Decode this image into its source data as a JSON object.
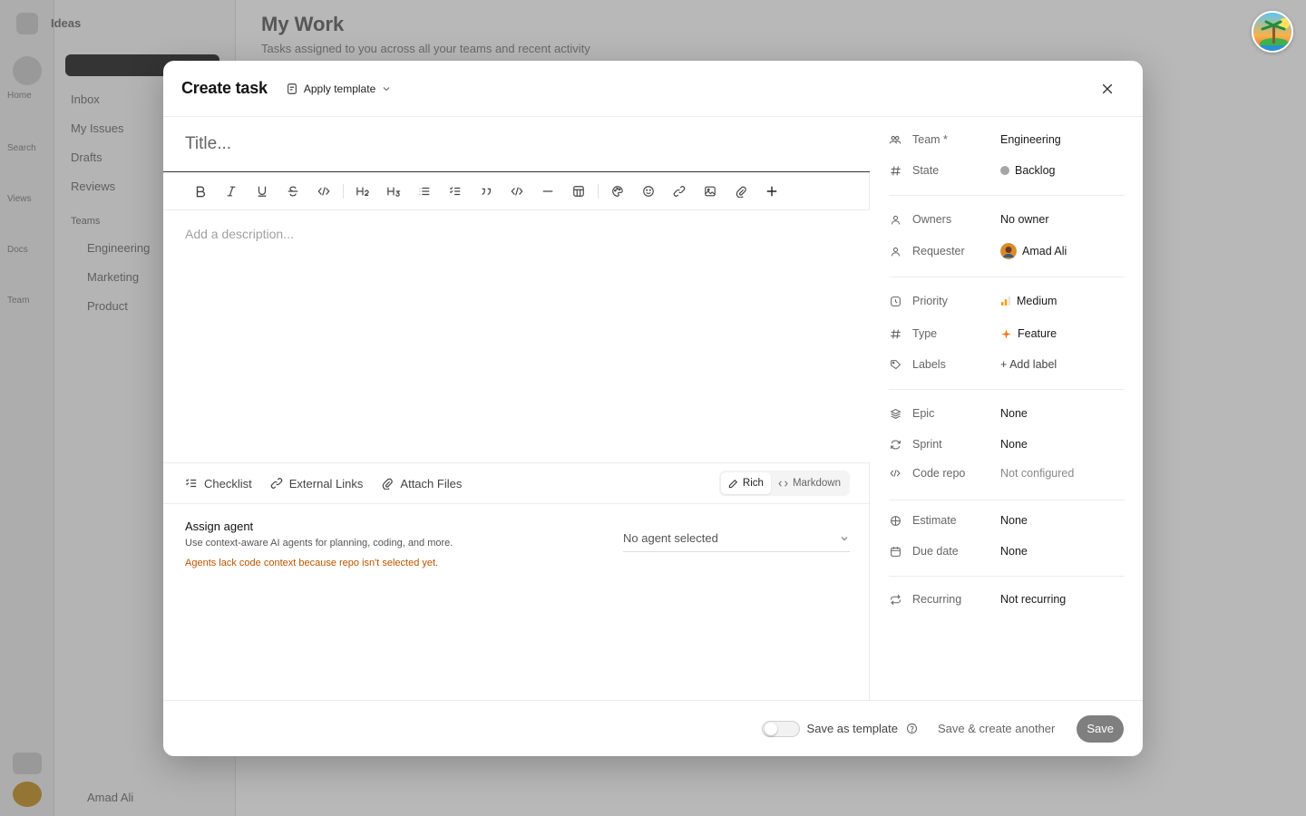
{
  "background": {
    "app_name": "Ideas",
    "page_title": "My Work",
    "page_subtitle": "Tasks assigned to you across all your teams and recent activity",
    "sidebar_items": [
      "Inbox",
      "My Issues",
      "Drafts",
      "Reviews",
      "Teams",
      "Engineering",
      "Marketing",
      "Product"
    ],
    "rail_labels": [
      "Home",
      "Search",
      "Views",
      "Docs",
      "Team"
    ],
    "bottom_user": "Amad Ali"
  },
  "modal": {
    "title": "Create task",
    "apply_template": "Apply template",
    "title_placeholder": "Title...",
    "description_placeholder": "Add a description...",
    "attachments": {
      "checklist": "Checklist",
      "external_links": "External Links",
      "attach_files": "Attach Files"
    },
    "mode": {
      "rich": "Rich",
      "markdown": "Markdown"
    },
    "agent": {
      "title": "Assign agent",
      "description": "Use context-aware AI agents for planning, coding, and more.",
      "warning": "Agents lack code context because repo isn't selected yet.",
      "select_value": "No agent selected"
    },
    "properties": {
      "team": {
        "label": "Team *",
        "value": "Engineering"
      },
      "state": {
        "label": "State",
        "value": "Backlog"
      },
      "owners": {
        "label": "Owners",
        "value": "No owner"
      },
      "requester": {
        "label": "Requester",
        "value": "Amad Ali"
      },
      "priority": {
        "label": "Priority",
        "value": "Medium"
      },
      "type": {
        "label": "Type",
        "value": "Feature"
      },
      "labels": {
        "label": "Labels",
        "value": "+ Add label"
      },
      "epic": {
        "label": "Epic",
        "value": "None"
      },
      "sprint": {
        "label": "Sprint",
        "value": "None"
      },
      "code_repo": {
        "label": "Code repo",
        "value": "Not configured"
      },
      "estimate": {
        "label": "Estimate",
        "value": "None"
      },
      "due_date": {
        "label": "Due date",
        "value": "None"
      },
      "recurring": {
        "label": "Recurring",
        "value": "Not recurring"
      }
    },
    "footer": {
      "save_as_template": "Save as template",
      "save_and_create_another": "Save & create another",
      "save": "Save"
    }
  },
  "colors": {
    "priority_accent": "#f59e0b",
    "feature_accent": "#f97316",
    "warning_text": "#b85400",
    "save_button": "#7f7f7f"
  }
}
